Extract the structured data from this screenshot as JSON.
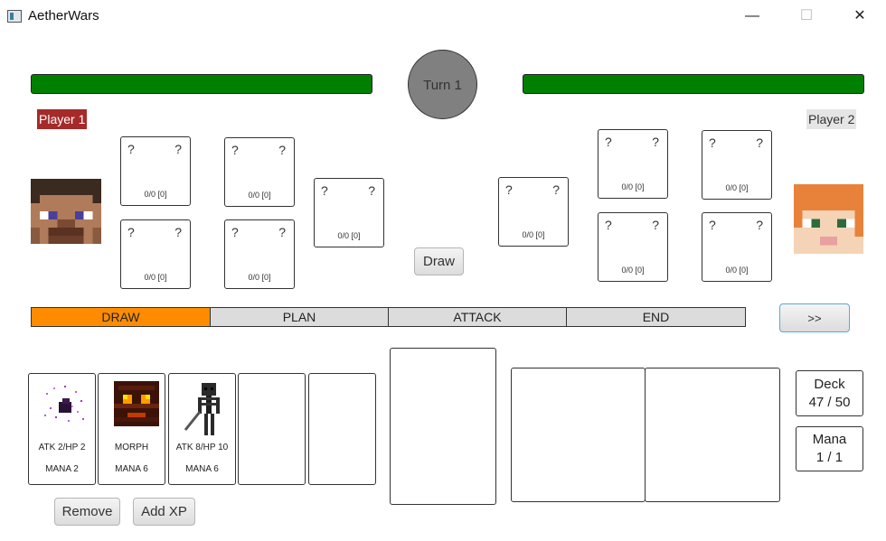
{
  "window": {
    "title": "AetherWars",
    "minimize": "—",
    "maximize": "☐",
    "close": "✕"
  },
  "turn": {
    "label": "Turn 1"
  },
  "players": {
    "p1": {
      "name": "Player 1",
      "hp_fraction": 1.0
    },
    "p2": {
      "name": "Player 2",
      "hp_fraction": 1.0
    }
  },
  "board": {
    "unknown": "?",
    "player1_slots": [
      {
        "stats": "0/0 [0]"
      },
      {
        "stats": "0/0 [0]"
      },
      {
        "stats": "0/0 [0]"
      },
      {
        "stats": "0/0 [0]"
      },
      {
        "stats": "0/0 [0]"
      }
    ],
    "player2_slots": [
      {
        "stats": "0/0 [0]"
      },
      {
        "stats": "0/0 [0]"
      },
      {
        "stats": "0/0 [0]"
      },
      {
        "stats": "0/0 [0]"
      },
      {
        "stats": "0/0 [0]"
      }
    ]
  },
  "buttons": {
    "draw": "Draw",
    "next": ">>",
    "remove": "Remove",
    "add_xp": "Add XP"
  },
  "phases": [
    {
      "label": "DRAW",
      "active": true
    },
    {
      "label": "PLAN",
      "active": false
    },
    {
      "label": "ATTACK",
      "active": false
    },
    {
      "label": "END",
      "active": false
    }
  ],
  "hand": [
    {
      "icon": "ender-creature-icon",
      "line1": "ATK 2/HP 2",
      "line2": "MANA 2"
    },
    {
      "icon": "magma-cube-icon",
      "line1": "MORPH",
      "line2": "MANA 6"
    },
    {
      "icon": "wither-skeleton-icon",
      "line1": "ATK 8/HP 10",
      "line2": "MANA 6"
    },
    {
      "line1": "",
      "line2": ""
    },
    {
      "line1": "",
      "line2": ""
    }
  ],
  "deck": {
    "label": "Deck",
    "value": "47 / 50"
  },
  "mana": {
    "label": "Mana",
    "value": "1 / 1"
  },
  "colors": {
    "hp": "#008000",
    "active_phase": "#ff8c00",
    "phase": "#dcdcdc",
    "p1_label": "#a52a2a"
  }
}
